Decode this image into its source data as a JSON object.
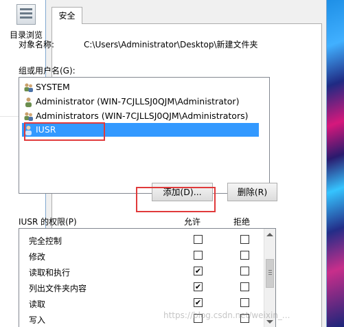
{
  "background": {
    "toolbar_label": "目录浏览",
    "icon": "directory-browse-icon"
  },
  "dialog": {
    "tab_label": "安全",
    "object_name_label": "对象名称:",
    "object_name_value": "C:\\Users\\Administrator\\Desktop\\新建文件夹",
    "group_label": "组或用户名(G):",
    "users": [
      {
        "name": "SYSTEM",
        "icon": "group-icon",
        "selected": false
      },
      {
        "name": "Administrator (WIN-7CJLLSJ0QJM\\Administrator)",
        "icon": "user-icon",
        "selected": false
      },
      {
        "name": "Administrators (WIN-7CJLLSJ0QJM\\Administrators)",
        "icon": "group-icon",
        "selected": false
      },
      {
        "name": "IUSR",
        "icon": "user-icon",
        "selected": true
      }
    ],
    "add_button": "添加(D)...",
    "remove_button": "删除(R)",
    "permissions_label": "IUSR 的权限(P)",
    "allow_header": "允许",
    "deny_header": "拒绝",
    "permissions": [
      {
        "name": "完全控制",
        "allow": false,
        "deny": false
      },
      {
        "name": "修改",
        "allow": false,
        "deny": false
      },
      {
        "name": "读取和执行",
        "allow": true,
        "deny": false
      },
      {
        "name": "列出文件夹内容",
        "allow": true,
        "deny": false
      },
      {
        "name": "读取",
        "allow": true,
        "deny": false
      },
      {
        "name": "写入",
        "allow": false,
        "deny": false
      }
    ]
  },
  "annotations": {
    "highlight_color": "#e0393a",
    "selection_color": "#3399ff"
  },
  "watermark": "https://blog.csdn.net/weixin_..."
}
